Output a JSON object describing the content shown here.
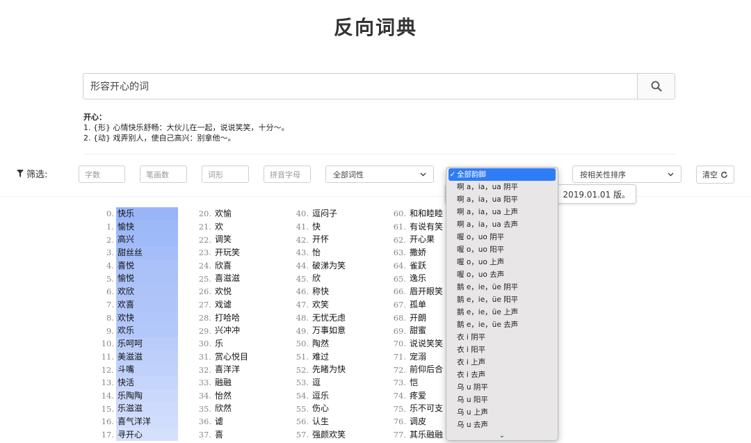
{
  "title": "反向词典",
  "search": {
    "value": "形容开心的词"
  },
  "definition": {
    "word": "开心：",
    "senses": [
      "1. {形} 心情快乐舒畅：大伙儿在一起，说说笑笑，十分～。",
      "2. {动} 戏弄别人，使自己高兴：别拿他～。"
    ]
  },
  "filter": {
    "label": "筛选:",
    "char_count": "字数",
    "stroke_count": "笔画数",
    "word_shape": "词形",
    "pinyin_letter": "拼音字母",
    "pos_select": "全部词性",
    "sort_select": "按相关性排序",
    "clear": "清空"
  },
  "tooltip": {
    "text": "》 2019.01.01 版。"
  },
  "rhyme_dropdown": {
    "selected": "全部韵脚",
    "options": [
      "啊 a，ia，ua 阴平",
      "啊 a，ia，ua 阳平",
      "啊 a，ia，ua 上声",
      "啊 a，ia，ua 去声",
      "喔 o，uo 阴平",
      "喔 o，uo 阳平",
      "喔 o，uo 上声",
      "喔 o，uo 去声",
      "鹅 e，ie，üe 阴平",
      "鹅 e，ie，üe 阳平",
      "鹅 e，ie，üe 上声",
      "鹅 e，ie，üe 去声",
      "衣 i 阴平",
      "衣 i 阳平",
      "衣 i 上声",
      "衣 i 去声",
      "乌 u 阴平",
      "乌 u 阳平",
      "乌 u 上声",
      "乌 u 去声"
    ]
  },
  "results": {
    "col0": [
      {
        "n": "0.",
        "w": "快乐",
        "rel": 1.0
      },
      {
        "n": "1.",
        "w": "愉快",
        "rel": 0.95
      },
      {
        "n": "2.",
        "w": "高兴",
        "rel": 0.92
      },
      {
        "n": "3.",
        "w": "甜丝丝",
        "rel": 0.85
      },
      {
        "n": "4.",
        "w": "喜悦",
        "rel": 0.8
      },
      {
        "n": "5.",
        "w": "愉悦",
        "rel": 0.78
      },
      {
        "n": "6.",
        "w": "欢欣",
        "rel": 0.75
      },
      {
        "n": "7.",
        "w": "欢喜",
        "rel": 0.72
      },
      {
        "n": "8.",
        "w": "欢快",
        "rel": 0.7
      },
      {
        "n": "9.",
        "w": "欢乐",
        "rel": 0.68
      },
      {
        "n": "10.",
        "w": "乐呵呵",
        "rel": 0.6
      },
      {
        "n": "11.",
        "w": "美滋滋",
        "rel": 0.55
      },
      {
        "n": "12.",
        "w": "斗嘴",
        "rel": 0.5
      },
      {
        "n": "13.",
        "w": "快活",
        "rel": 0.45
      },
      {
        "n": "14.",
        "w": "乐陶陶",
        "rel": 0.4
      },
      {
        "n": "15.",
        "w": "乐滋滋",
        "rel": 0.35
      },
      {
        "n": "16.",
        "w": "喜气洋洋",
        "rel": 0.3
      },
      {
        "n": "17.",
        "w": "寻开心",
        "rel": 0.25
      }
    ],
    "col1": [
      {
        "n": "20.",
        "w": "欢愉"
      },
      {
        "n": "21.",
        "w": "欢"
      },
      {
        "n": "22.",
        "w": "调笑"
      },
      {
        "n": "23.",
        "w": "开玩笑"
      },
      {
        "n": "24.",
        "w": "欣喜"
      },
      {
        "n": "25.",
        "w": "喜滋滋"
      },
      {
        "n": "26.",
        "w": "欢悦"
      },
      {
        "n": "27.",
        "w": "戏谑"
      },
      {
        "n": "28.",
        "w": "打哈哈"
      },
      {
        "n": "29.",
        "w": "兴冲冲"
      },
      {
        "n": "30.",
        "w": "乐"
      },
      {
        "n": "31.",
        "w": "赏心悦目"
      },
      {
        "n": "32.",
        "w": "喜洋洋"
      },
      {
        "n": "33.",
        "w": "融融"
      },
      {
        "n": "34.",
        "w": "怡然"
      },
      {
        "n": "35.",
        "w": "欣然"
      },
      {
        "n": "36.",
        "w": "谑"
      },
      {
        "n": "37.",
        "w": "喜"
      }
    ],
    "col2": [
      {
        "n": "40.",
        "w": "逗闷子"
      },
      {
        "n": "41.",
        "w": "快"
      },
      {
        "n": "42.",
        "w": "开怀"
      },
      {
        "n": "43.",
        "w": "怡"
      },
      {
        "n": "44.",
        "w": "破涕为笑"
      },
      {
        "n": "45.",
        "w": "欣"
      },
      {
        "n": "46.",
        "w": "称快"
      },
      {
        "n": "47.",
        "w": "欢笑"
      },
      {
        "n": "48.",
        "w": "无忧无虑"
      },
      {
        "n": "49.",
        "w": "万事如意"
      },
      {
        "n": "50.",
        "w": "陶然"
      },
      {
        "n": "51.",
        "w": "难过"
      },
      {
        "n": "52.",
        "w": "先睹为快"
      },
      {
        "n": "53.",
        "w": "逗"
      },
      {
        "n": "54.",
        "w": "逗乐"
      },
      {
        "n": "55.",
        "w": "伤心"
      },
      {
        "n": "56.",
        "w": "认生"
      },
      {
        "n": "57.",
        "w": "强颜欢笑"
      }
    ],
    "col3": [
      {
        "n": "60.",
        "w": "和和睦睦"
      },
      {
        "n": "61.",
        "w": "有说有笑"
      },
      {
        "n": "62.",
        "w": "开心果"
      },
      {
        "n": "63.",
        "w": "撒娇"
      },
      {
        "n": "64.",
        "w": "雀跃"
      },
      {
        "n": "65.",
        "w": "逸乐"
      },
      {
        "n": "66.",
        "w": "眉开眼笑"
      },
      {
        "n": "67.",
        "w": "孤单"
      },
      {
        "n": "68.",
        "w": "开朗"
      },
      {
        "n": "69.",
        "w": "甜蜜"
      },
      {
        "n": "70.",
        "w": "说说笑笑"
      },
      {
        "n": "71.",
        "w": "宠溺"
      },
      {
        "n": "72.",
        "w": "前仰后合"
      },
      {
        "n": "73.",
        "w": "恺"
      },
      {
        "n": "74.",
        "w": "疼爱"
      },
      {
        "n": "75.",
        "w": "乐不可支"
      },
      {
        "n": "76.",
        "w": "调皮"
      },
      {
        "n": "77.",
        "w": "其乐融融"
      }
    ]
  }
}
